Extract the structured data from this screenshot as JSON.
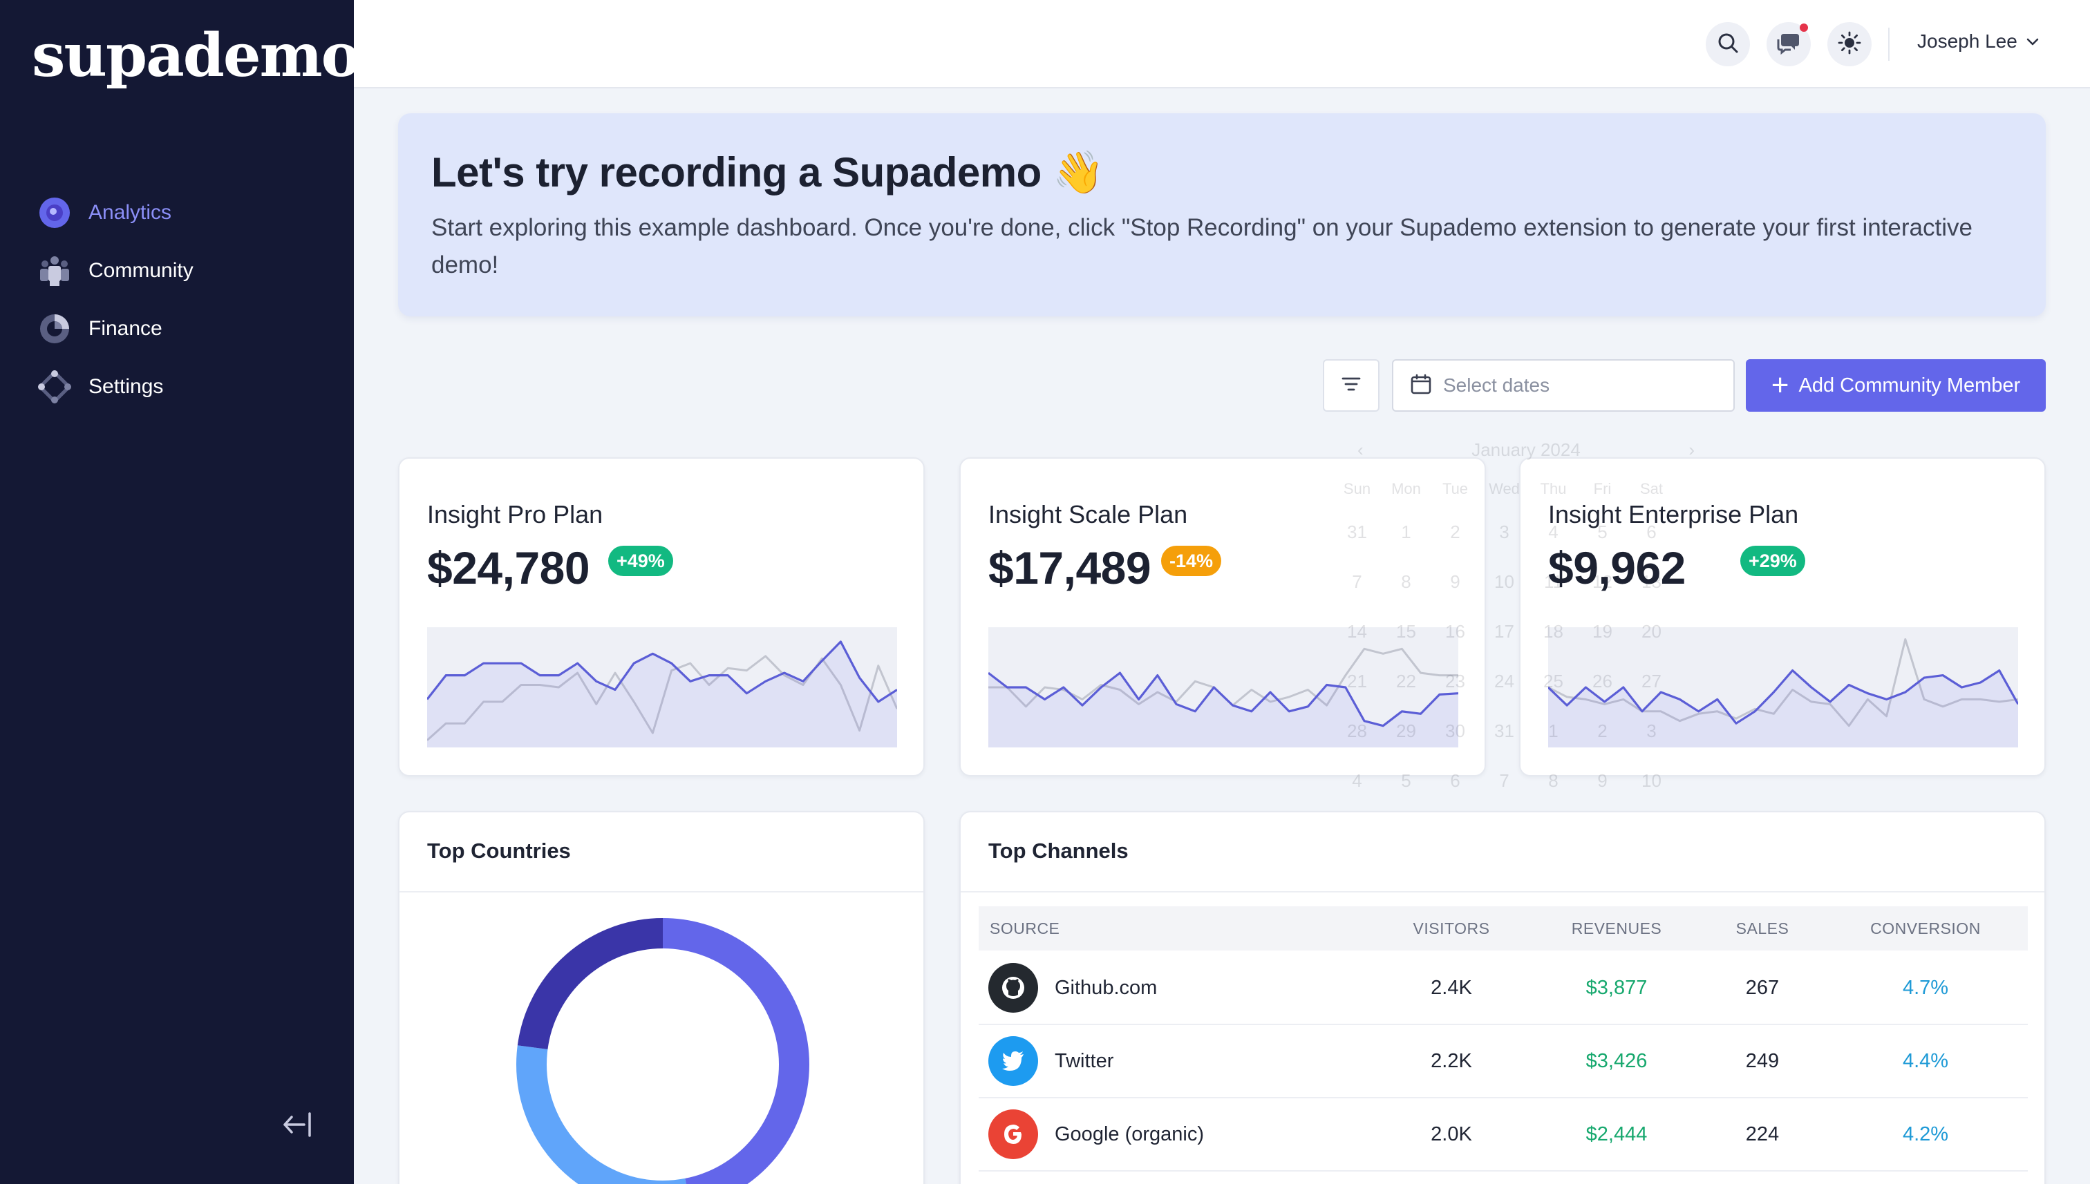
{
  "brand": {
    "logo": "supademo"
  },
  "sidebar": {
    "items": [
      {
        "label": "Analytics",
        "icon": "analytics-icon",
        "active": true
      },
      {
        "label": "Community",
        "icon": "community-icon",
        "active": false
      },
      {
        "label": "Finance",
        "icon": "finance-icon",
        "active": false
      },
      {
        "label": "Settings",
        "icon": "settings-icon",
        "active": false
      }
    ],
    "collapse_icon": "collapse-sidebar-icon"
  },
  "header": {
    "user_name": "Joseph Lee",
    "icons": [
      "search-icon",
      "chat-icon",
      "theme-icon"
    ]
  },
  "banner": {
    "title": "Let's try recording a Supademo 👋",
    "text": "Start exploring this example dashboard. Once you're done, click \"Stop Recording\" on your Supademo extension to generate your first interactive demo!"
  },
  "toolbar": {
    "date_placeholder": "Select dates",
    "add_label": "Add Community Member"
  },
  "calendar": {
    "month": "January 2024",
    "weekdays": [
      "Sun",
      "Mon",
      "Tue",
      "Wed",
      "Thu",
      "Fri",
      "Sat"
    ],
    "days": [
      "31",
      "1",
      "2",
      "3",
      "4",
      "5",
      "6",
      "7",
      "8",
      "9",
      "10",
      "11",
      "12",
      "13",
      "14",
      "15",
      "16",
      "17",
      "18",
      "19",
      "20",
      "21",
      "22",
      "23",
      "24",
      "25",
      "26",
      "27",
      "28",
      "29",
      "30",
      "31",
      "1",
      "2",
      "3",
      "4",
      "5",
      "6",
      "7",
      "8",
      "9",
      "10"
    ]
  },
  "stats": [
    {
      "title": "Insight Pro Plan",
      "value": "$24,780",
      "change": "+49%",
      "trend": "up",
      "chart_data": {
        "type": "line",
        "series": [
          {
            "values": [
              40,
              60,
              60,
              70,
              70,
              70,
              60,
              60,
              70,
              55,
              48,
              70,
              78,
              70,
              55,
              60,
              60,
              45,
              55,
              62,
              55,
              72,
              88,
              58,
              38,
              48
            ]
          },
          {
            "values": [
              6,
              20,
              20,
              38,
              38,
              52,
              52,
              50,
              62,
              36,
              62,
              38,
              12,
              64,
              70,
              52,
              66,
              64,
              76,
              60,
              52,
              74,
              52,
              14,
              68,
              32
            ]
          }
        ]
      }
    },
    {
      "title": "Insight Scale Plan",
      "value": "$17,489",
      "change": "-14%",
      "trend": "down",
      "chart_data": {
        "type": "line",
        "series": [
          {
            "values": [
              62,
              50,
              50,
              40,
              50,
              35,
              50,
              62,
              40,
              60,
              36,
              30,
              50,
              35,
              30,
              46,
              30,
              34,
              52,
              50,
              22,
              18,
              30,
              28,
              44,
              45
            ]
          },
          {
            "values": [
              50,
              50,
              34,
              50,
              48,
              40,
              52,
              48,
              36,
              46,
              38,
              55,
              50,
              35,
              48,
              38,
              42,
              48,
              35,
              60,
              82,
              78,
              82,
              62,
              60,
              60
            ]
          }
        ]
      }
    },
    {
      "title": "Insight Enterprise Plan",
      "value": "$9,962",
      "change": "+29%",
      "trend": "up",
      "chart_data": {
        "type": "line",
        "series": [
          {
            "values": [
              50,
              35,
              50,
              38,
              50,
              30,
              46,
              40,
              30,
              40,
              20,
              30,
              46,
              64,
              50,
              38,
              52,
              45,
              40,
              46,
              58,
              60,
              50,
              54,
              64,
              36
            ]
          },
          {
            "values": [
              50,
              42,
              40,
              36,
              40,
              30,
              30,
              22,
              28,
              30,
              24,
              32,
              28,
              48,
              38,
              36,
              18,
              40,
              26,
              90,
              40,
              34,
              40,
              40,
              38,
              40
            ]
          }
        ]
      }
    }
  ],
  "top_countries": {
    "title": "Top Countries"
  },
  "top_channels": {
    "title": "Top Channels",
    "columns": [
      "SOURCE",
      "VISITORS",
      "REVENUES",
      "SALES",
      "CONVERSION"
    ],
    "rows": [
      {
        "source": "Github.com",
        "icon": "github-icon",
        "icon_bg": "#24292f",
        "visitors": "2.4K",
        "revenues": "$3,877",
        "sales": "267",
        "conversion": "4.7%"
      },
      {
        "source": "Twitter",
        "icon": "twitter-icon",
        "icon_bg": "#1d9bf0",
        "visitors": "2.2K",
        "revenues": "$3,426",
        "sales": "249",
        "conversion": "4.4%"
      },
      {
        "source": "Google (organic)",
        "icon": "google-icon",
        "icon_bg": "#ea4335",
        "visitors": "2.0K",
        "revenues": "$2,444",
        "sales": "224",
        "conversion": "4.2%"
      }
    ]
  },
  "colors": {
    "sidebar_bg": "#141834",
    "accent": "#6366ea",
    "positive": "#12b981",
    "warning": "#f59f0a",
    "donut": [
      "#6366ea",
      "#3a35a8",
      "#60a5fa"
    ]
  }
}
